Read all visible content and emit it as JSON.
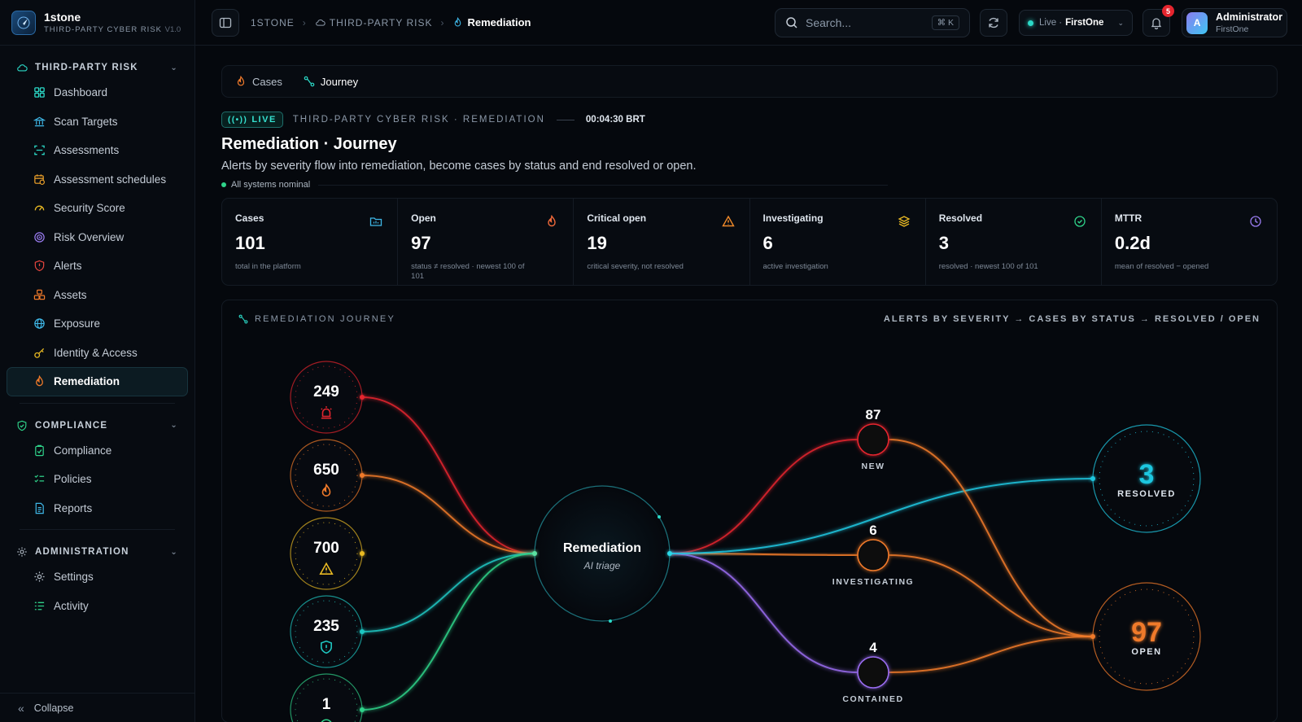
{
  "brand": {
    "name": "1stone",
    "subtitle": "THIRD-PARTY CYBER RISK",
    "version": "V1.0"
  },
  "sidebar": {
    "sections": [
      {
        "title": "THIRD-PARTY RISK",
        "items": [
          "Dashboard",
          "Scan Targets",
          "Assessments",
          "Assessment schedules",
          "Security Score",
          "Risk Overview",
          "Alerts",
          "Assets",
          "Exposure",
          "Identity & Access",
          "Remediation"
        ]
      },
      {
        "title": "COMPLIANCE",
        "items": [
          "Compliance",
          "Policies",
          "Reports"
        ]
      },
      {
        "title": "ADMINISTRATION",
        "items": [
          "Settings",
          "Activity"
        ]
      }
    ],
    "active_item": "Remediation",
    "collapse_label": "Collapse"
  },
  "topbar": {
    "breadcrumb": [
      "1STONE",
      "THIRD-PARTY RISK",
      "Remediation"
    ],
    "search_placeholder": "Search...",
    "search_shortcut": "⌘ K",
    "live_label": "Live ·",
    "tenant": "FirstOne",
    "notifications": "5",
    "user": {
      "initial": "A",
      "name": "Administrator",
      "org": "FirstOne"
    }
  },
  "tabs": [
    "Cases",
    "Journey"
  ],
  "active_tab": "Journey",
  "header": {
    "live_tag": "LIVE",
    "context": "THIRD-PARTY CYBER RISK · REMEDIATION",
    "time": "00:04:30 BRT",
    "title": "Remediation · Journey",
    "description": "Alerts by severity flow into remediation, become cases by status and end resolved or open.",
    "status": "All systems nominal"
  },
  "stats": [
    {
      "label": "Cases",
      "value": "101",
      "note": "total in the platform",
      "icon": "folder-icon",
      "color": "#3fb8e8"
    },
    {
      "label": "Open",
      "value": "97",
      "note": "status ≠ resolved · newest 100 of 101",
      "icon": "flame-icon",
      "color": "#f0693a"
    },
    {
      "label": "Critical open",
      "value": "19",
      "note": "critical severity, not resolved",
      "icon": "warning-icon",
      "color": "#f08a2a"
    },
    {
      "label": "Investigating",
      "value": "6",
      "note": "active investigation",
      "icon": "layers-icon",
      "color": "#e8b923"
    },
    {
      "label": "Resolved",
      "value": "3",
      "note": "resolved · newest 100 of 101",
      "icon": "check-circle-icon",
      "color": "#2fd38a"
    },
    {
      "label": "MTTR",
      "value": "0.2d",
      "note": "mean of resolved − opened",
      "icon": "clock-icon",
      "color": "#9a7cf0"
    }
  ],
  "journey": {
    "title": "REMEDIATION JOURNEY",
    "flow_caption": "ALERTS BY SEVERITY → CASES BY STATUS → RESOLVED / OPEN",
    "severity_nodes": [
      {
        "value": "249",
        "icon": "siren-icon",
        "color": "#e5252e"
      },
      {
        "value": "650",
        "icon": "flame-icon",
        "color": "#f07a2a"
      },
      {
        "value": "700",
        "icon": "warning-icon",
        "color": "#e8b923"
      },
      {
        "value": "235",
        "icon": "shield-icon",
        "color": "#1fc7c2"
      },
      {
        "value": "1",
        "icon": "info-icon",
        "color": "#2fd38a"
      }
    ],
    "hub": {
      "title": "Remediation",
      "subtitle": "AI triage"
    },
    "status_nodes": [
      {
        "value": "87",
        "label": "NEW",
        "color": "#e5252e"
      },
      {
        "value": "6",
        "label": "INVESTIGATING",
        "color": "#f07a2a"
      },
      {
        "value": "4",
        "label": "CONTAINED",
        "color": "#9a6cf0"
      }
    ],
    "outcomes": [
      {
        "value": "3",
        "label": "RESOLVED",
        "color": "#1fc7e0"
      },
      {
        "value": "97",
        "label": "OPEN",
        "color": "#f07a2a"
      }
    ]
  }
}
